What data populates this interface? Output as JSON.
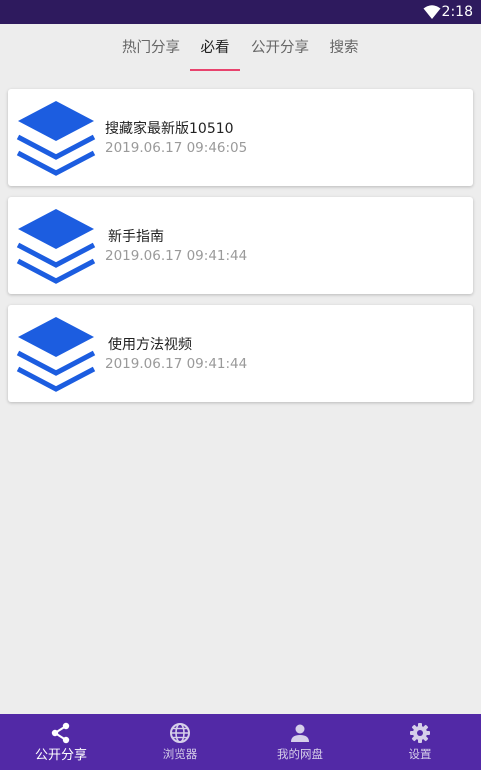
{
  "status_bar": {
    "time": "2:18",
    "wifi_icon": "wifi-icon"
  },
  "tabs": [
    {
      "label": "热门分享",
      "active": false
    },
    {
      "label": "必看",
      "active": true
    },
    {
      "label": "公开分享",
      "active": false
    },
    {
      "label": "搜索",
      "active": false
    }
  ],
  "accent_color": "#e8436d",
  "list": [
    {
      "title": "搜藏家最新版10510",
      "time": "2019.06.17 09:46:05",
      "icon": "layers-stack-icon"
    },
    {
      "title": "新手指南",
      "time": "2019.06.17 09:41:44",
      "icon": "layers-stack-icon"
    },
    {
      "title": "使用方法视频",
      "time": "2019.06.17 09:41:44",
      "icon": "layers-stack-icon"
    }
  ],
  "bottom_nav": [
    {
      "label": "公开分享",
      "icon": "share-icon",
      "active": true
    },
    {
      "label": "浏览器",
      "icon": "globe-icon",
      "active": false
    },
    {
      "label": "我的网盘",
      "icon": "person-icon",
      "active": false
    },
    {
      "label": "设置",
      "icon": "gear-icon",
      "active": false
    }
  ],
  "colors": {
    "status_bar": "#2e1a5e",
    "bottom_nav": "#5229a6",
    "stack_icon": "#1c5de0",
    "background": "#ededed"
  }
}
